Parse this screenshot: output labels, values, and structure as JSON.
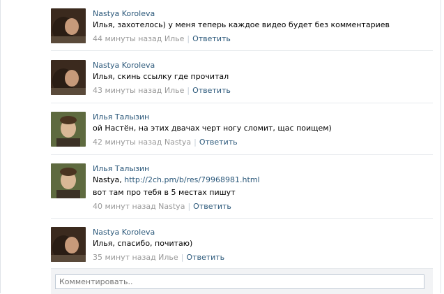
{
  "comments": [
    {
      "author": "Nastya Koroleva",
      "text": "Илья, захотелось) у меня теперь каждое видео будет без комментариев",
      "time": "44 минуты назад Илье",
      "reply": "Ответить"
    },
    {
      "author": "Nastya Koroleva",
      "text": "Илья, скинь ссылку где прочитал",
      "time": "43 минуты назад Илье",
      "reply": "Ответить"
    },
    {
      "author": "Илья Талызин",
      "text": "ой Настён, на этих двачах черт ногу сломит, щас поищем)",
      "time": "42 минуты назад Nastya",
      "reply": "Ответить"
    },
    {
      "author": "Илья Талызин",
      "text_prefix": "Nastya, ",
      "link": "http://2ch.pm/b/res/79968981.html",
      "text_line2": "вот там про тебя в 5 местах пишут",
      "time": "40 минут назад Nastya",
      "reply": "Ответить"
    },
    {
      "author": "Nastya Koroleva",
      "text": "Илья, спасибо, почитаю)",
      "time": "35 минут назад Илье",
      "reply": "Ответить"
    }
  ],
  "comment_input": {
    "placeholder": "Комментировать.."
  }
}
